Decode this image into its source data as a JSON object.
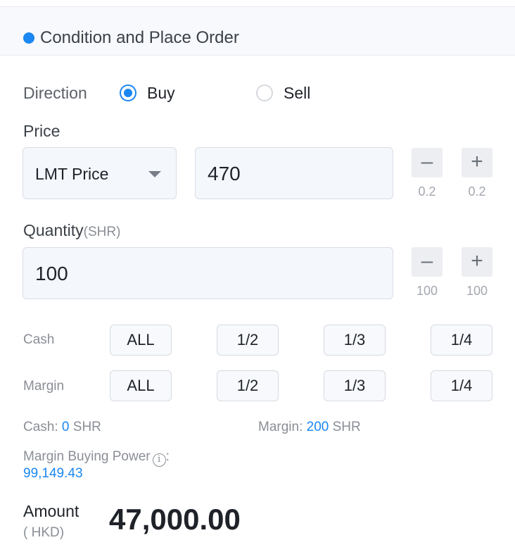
{
  "header": {
    "title": "Condition and Place Order"
  },
  "direction": {
    "label": "Direction",
    "options": [
      {
        "label": "Buy",
        "selected": true
      },
      {
        "label": "Sell",
        "selected": false
      }
    ]
  },
  "price": {
    "label": "Price",
    "type_value": "LMT Price",
    "value": "470",
    "minus_label": "–",
    "plus_label": "+",
    "minus_step": "0.2",
    "plus_step": "0.2"
  },
  "quantity": {
    "label": "Quantity",
    "unit": "(SHR)",
    "value": "100",
    "minus_label": "–",
    "plus_label": "+",
    "minus_step": "100",
    "plus_step": "100"
  },
  "cash_row": {
    "label": "Cash",
    "options": [
      "ALL",
      "1/2",
      "1/3",
      "1/4"
    ]
  },
  "margin_row": {
    "label": "Margin",
    "options": [
      "ALL",
      "1/2",
      "1/3",
      "1/4"
    ]
  },
  "summary": {
    "cash_label": "Cash:",
    "cash_value": "0",
    "cash_unit": "SHR",
    "margin_label": "Margin:",
    "margin_value": "200",
    "margin_unit": "SHR"
  },
  "buying_power": {
    "label": "Margin Buying Power",
    "info_glyph": "i",
    "suffix": ":",
    "value": "99,149.43"
  },
  "amount": {
    "label": "Amount",
    "unit": "( HKD)",
    "value": "47,000.00"
  },
  "colors": {
    "accent": "#1b87f2",
    "field_bg": "#f4f7fb",
    "header_bg": "#f7f9fc"
  }
}
